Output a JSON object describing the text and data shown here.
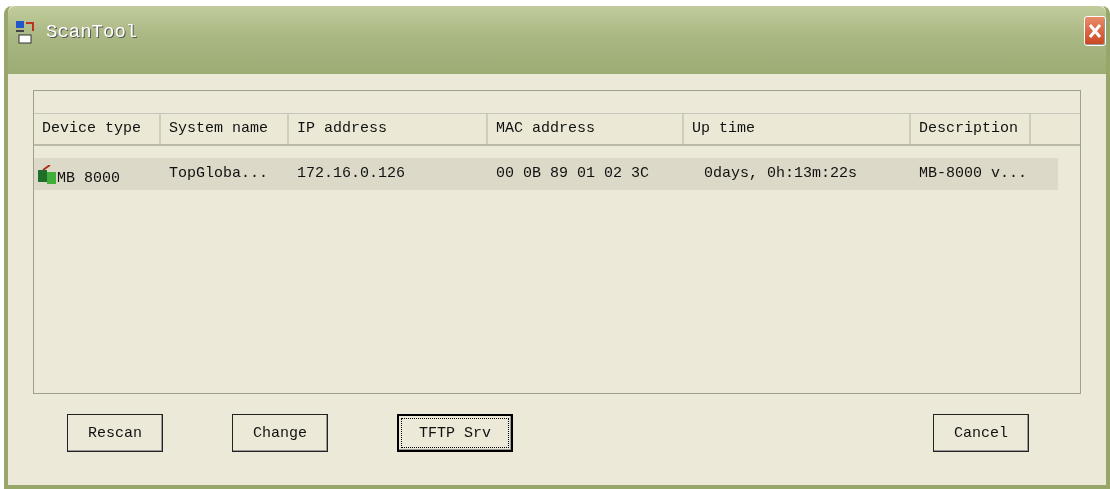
{
  "window": {
    "title": "ScanTool"
  },
  "table": {
    "columns": [
      "Device type",
      "System name",
      "IP address",
      "MAC address",
      "Up time",
      "Description"
    ],
    "rows": [
      {
        "selected": true,
        "cells": [
          "MB 8000",
          "TopGloba...",
          "172.16.0.126",
          "00 0B 89 01 02 3C",
          "0days, 0h:13m:22s",
          "MB-8000 v..."
        ]
      }
    ]
  },
  "buttons": [
    {
      "label": "Rescan",
      "focused": false
    },
    {
      "label": "Change",
      "focused": false
    },
    {
      "label": "TFTP Srv",
      "focused": true
    },
    {
      "label": "Cancel",
      "focused": false
    }
  ]
}
